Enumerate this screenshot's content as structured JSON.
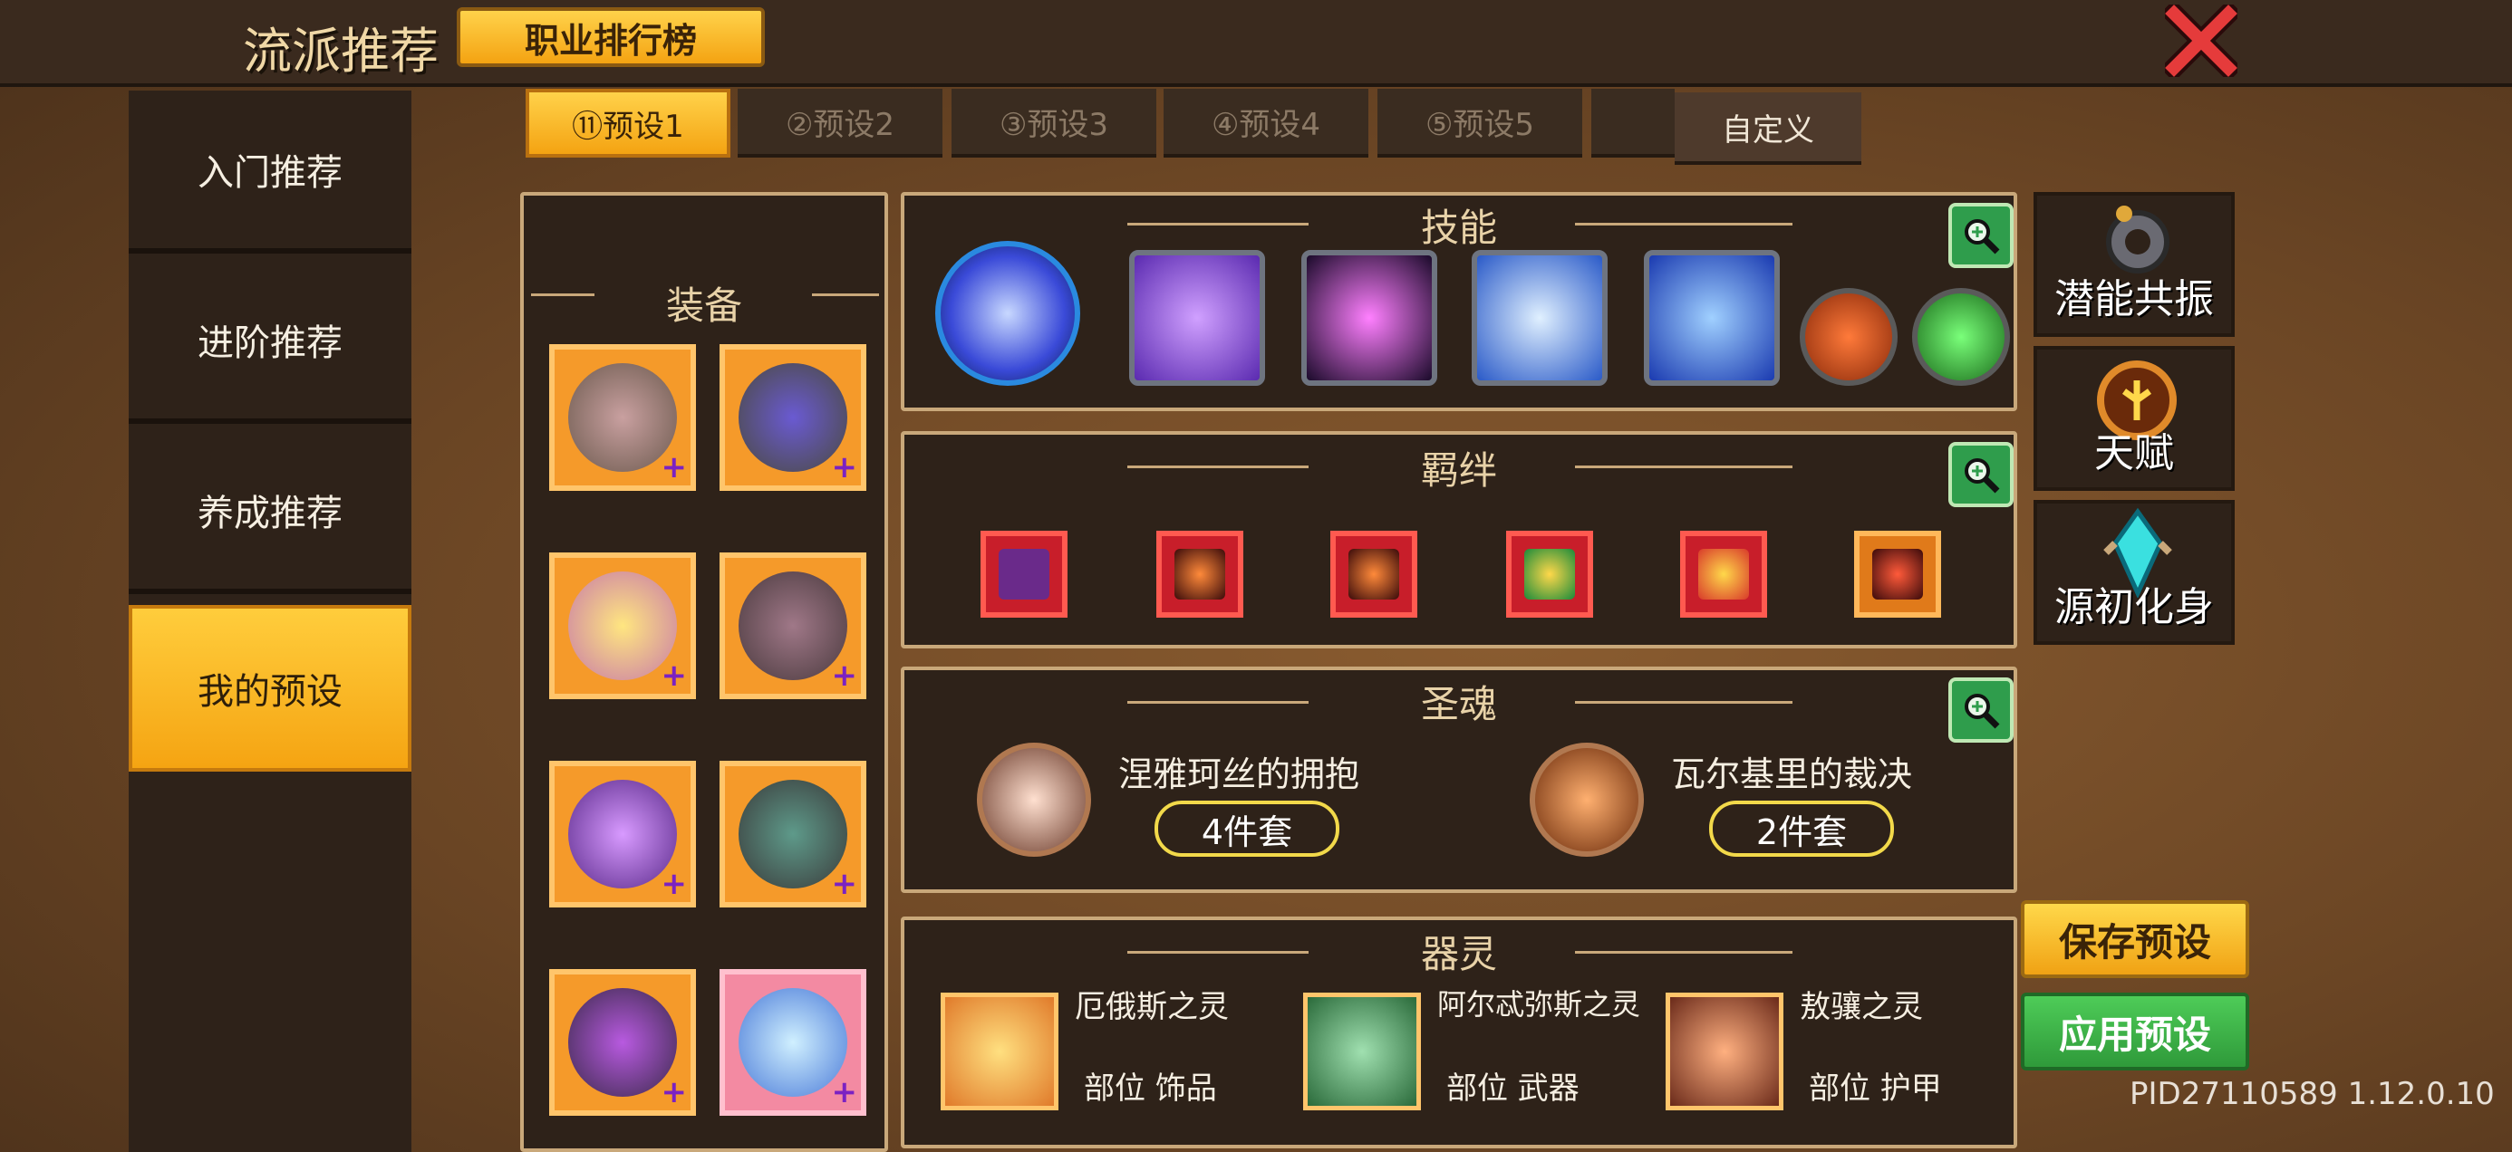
{
  "header": {
    "title": "流派推荐",
    "rank_button": "职业排行榜"
  },
  "sidebar": {
    "items": [
      {
        "label": "入门推荐"
      },
      {
        "label": "进阶推荐"
      },
      {
        "label": "养成推荐"
      },
      {
        "label": "我的预设"
      }
    ]
  },
  "tabs": [
    {
      "label": "⑪预设1"
    },
    {
      "label": "②预设2"
    },
    {
      "label": "③预设3"
    },
    {
      "label": "④预设4"
    },
    {
      "label": "⑤预设5"
    },
    {
      "label": "自定义"
    }
  ],
  "equipment": {
    "title": "装备"
  },
  "skills": {
    "title": "技能"
  },
  "bonds": {
    "title": "羁绊"
  },
  "holy_soul": {
    "title": "圣魂",
    "entries": [
      {
        "name": "涅雅珂丝的拥抱",
        "set": "4件套"
      },
      {
        "name": "瓦尔基里的裁决",
        "set": "2件套"
      }
    ]
  },
  "spirits": {
    "title": "器灵",
    "entries": [
      {
        "name": "厄俄斯之灵",
        "part": "部位 饰品"
      },
      {
        "name": "阿尔忒弥斯之灵",
        "part": "部位 武器"
      },
      {
        "name": "敖骧之灵",
        "part": "部位 护甲"
      }
    ]
  },
  "right_panel": {
    "resonance": "潜能共振",
    "talent": "天赋",
    "avatar": "源初化身"
  },
  "actions": {
    "save": "保存预设",
    "apply": "应用预设"
  },
  "version": "PID27110589 1.12.0.10",
  "colors": {
    "accent": "#f4a312",
    "panel": "#2e2219",
    "apply": "#2f9a3a"
  }
}
